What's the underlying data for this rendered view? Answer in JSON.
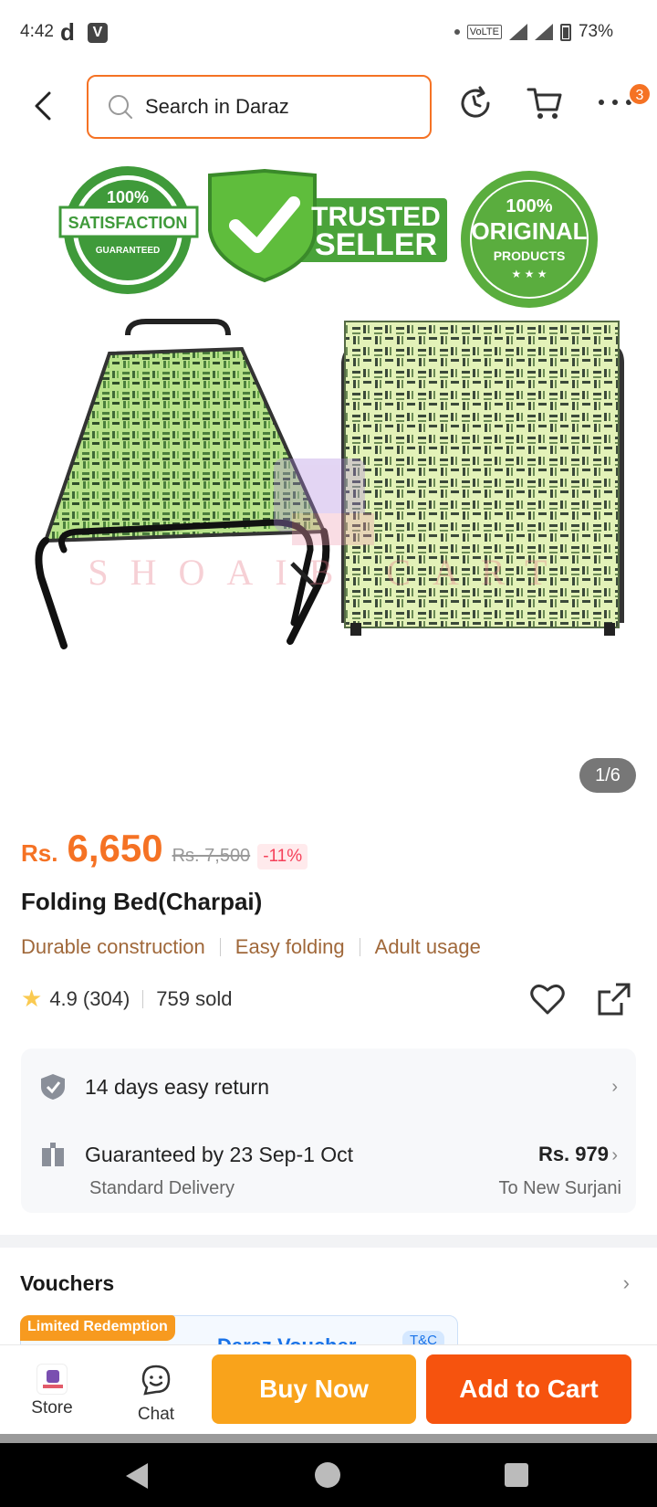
{
  "status": {
    "time": "4:42",
    "d_icon": "d",
    "v_icon": "V",
    "volte": "VoLTE",
    "battery": "73%"
  },
  "search": {
    "placeholder": "Search in Daraz"
  },
  "cart": {
    "badge": "3"
  },
  "hero": {
    "badge_left_top": "100%",
    "badge_left_main": "SATISFACTION",
    "badge_left_sub": "GUARANTEED",
    "badge_center_line1": "TRUSTED",
    "badge_center_line2": "SELLER",
    "badge_right_top": "100%",
    "badge_right_main": "ORIGINAL",
    "badge_right_sub": "PRODUCTS",
    "watermark": "SHOAIB CART",
    "counter": "1/6"
  },
  "price": {
    "currency": "Rs.",
    "value": "6,650",
    "original": "Rs. 7,500",
    "discount": "-11%"
  },
  "product": {
    "title": "Folding Bed(Charpai)",
    "tags": [
      "Durable construction",
      "Easy folding",
      "Adult usage"
    ],
    "rating": "4.9",
    "reviews": "(304)",
    "sold": "759 sold"
  },
  "service": {
    "returns": "14 days easy return",
    "delivery": "Guaranteed by 23 Sep-1 Oct",
    "delivery_type": "Standard Delivery",
    "fee": "Rs. 979",
    "location": "To New Surjani"
  },
  "vouchers": {
    "title": "Vouchers",
    "limited": "Limited Redemption",
    "name": "Daraz Voucher",
    "tc": "T&C"
  },
  "bottom": {
    "store": "Store",
    "chat": "Chat",
    "buy_now": "Buy Now",
    "add_to_cart": "Add to Cart"
  },
  "colors": {
    "brand_orange": "#f57224",
    "buy_now": "#f9a31b",
    "add_to_cart": "#f6530e",
    "tag_brown": "#a0683a"
  }
}
